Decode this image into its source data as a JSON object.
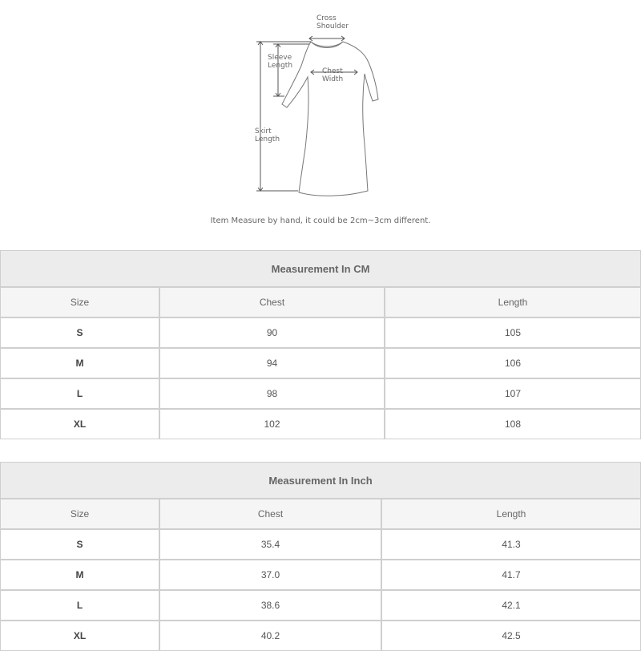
{
  "diagram": {
    "labels": {
      "cross_shoulder": [
        "Cross",
        "Shoulder"
      ],
      "sleeve_length": [
        "Sleeve",
        "Length"
      ],
      "chest_width": [
        "Chest",
        "Width"
      ],
      "skirt_length": [
        "Skirt",
        "Length"
      ]
    },
    "note": "Item Measure by hand, it could be 2cm~3cm different."
  },
  "tables": [
    {
      "title": "Measurement In CM",
      "columns": [
        "Size",
        "Chest",
        "Length"
      ],
      "rows": [
        [
          "S",
          "90",
          "105"
        ],
        [
          "M",
          "94",
          "106"
        ],
        [
          "L",
          "98",
          "107"
        ],
        [
          "XL",
          "102",
          "108"
        ]
      ]
    },
    {
      "title": "Measurement In Inch",
      "columns": [
        "Size",
        "Chest",
        "Length"
      ],
      "rows": [
        [
          "S",
          "35.4",
          "41.3"
        ],
        [
          "M",
          "37.0",
          "41.7"
        ],
        [
          "L",
          "38.6",
          "42.1"
        ],
        [
          "XL",
          "40.2",
          "42.5"
        ]
      ]
    }
  ]
}
